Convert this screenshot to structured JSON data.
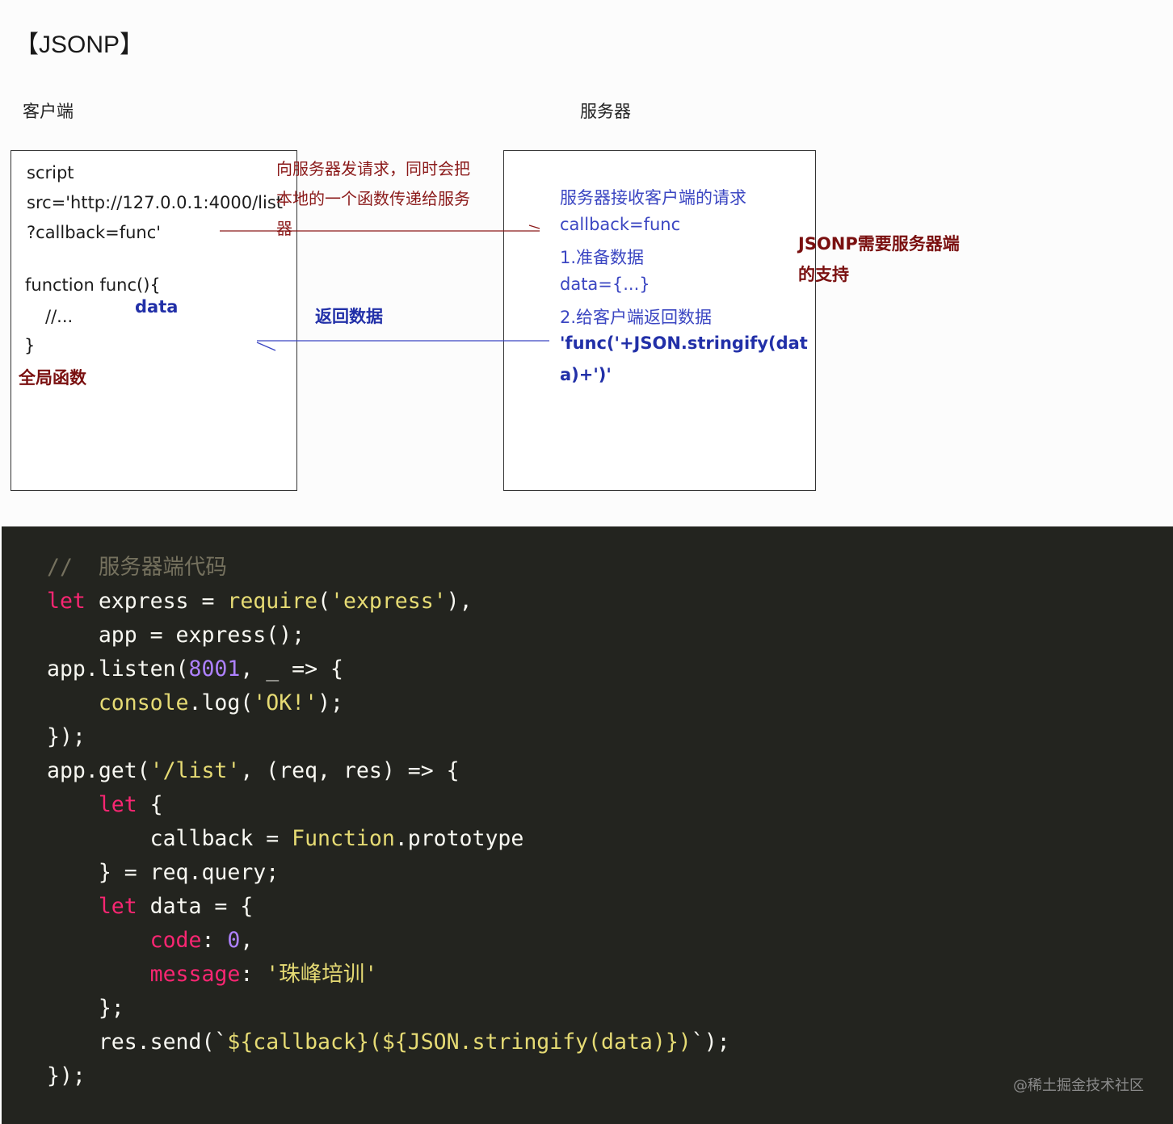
{
  "diagram": {
    "title": "【JSONP】",
    "client_label": "客户端",
    "server_label": "服务器",
    "client_box": {
      "line1": "script",
      "line2": "src='http://127.0.0.1:4000/list",
      "line3": "?callback=func'",
      "line4": "function func(){",
      "line5": "//...",
      "line6": "}",
      "data_label": "data",
      "global_label": "全局函数"
    },
    "request_note": {
      "line1": "向服务器发请求，同时会把",
      "line2": "本地的一个函数传递给服务",
      "line3": "器"
    },
    "return_label": "返回数据",
    "server_box": {
      "line1": "服务器接收客户端的请求",
      "line2": "callback=func",
      "line3": "1.准备数据",
      "line4": "data={...}",
      "line5": "2.给客户端返回数据",
      "line6": "'func('+JSON.stringify(dat",
      "line7": "a)+')'"
    },
    "side_note": {
      "line1": "JSONP需要服务器端",
      "line2": "的支持"
    }
  },
  "code": {
    "lines": [
      [
        {
          "t": "//  服务器端代码",
          "c": "cm"
        }
      ],
      [
        {
          "t": "let",
          "c": "kw"
        },
        {
          "t": " express = ",
          "c": "plain"
        },
        {
          "t": "require",
          "c": "fn"
        },
        {
          "t": "(",
          "c": "plain"
        },
        {
          "t": "'express'",
          "c": "str"
        },
        {
          "t": "),",
          "c": "plain"
        }
      ],
      [
        {
          "t": "    app = express();",
          "c": "plain"
        }
      ],
      [
        {
          "t": "app.listen(",
          "c": "plain"
        },
        {
          "t": "8001",
          "c": "num"
        },
        {
          "t": ", _ => {",
          "c": "plain"
        }
      ],
      [
        {
          "t": "    ",
          "c": "plain"
        },
        {
          "t": "console",
          "c": "fn"
        },
        {
          "t": ".log(",
          "c": "plain"
        },
        {
          "t": "'OK!'",
          "c": "str"
        },
        {
          "t": ");",
          "c": "plain"
        }
      ],
      [
        {
          "t": "});",
          "c": "plain"
        }
      ],
      [
        {
          "t": "app.get(",
          "c": "plain"
        },
        {
          "t": "'/list'",
          "c": "str"
        },
        {
          "t": ", (req, res) => {",
          "c": "plain"
        }
      ],
      [
        {
          "t": "    ",
          "c": "plain"
        },
        {
          "t": "let",
          "c": "kw"
        },
        {
          "t": " {",
          "c": "plain"
        }
      ],
      [
        {
          "t": "        callback = ",
          "c": "plain"
        },
        {
          "t": "Function",
          "c": "fn"
        },
        {
          "t": ".prototype",
          "c": "plain"
        }
      ],
      [
        {
          "t": "    } = req.query;",
          "c": "plain"
        }
      ],
      [
        {
          "t": "    ",
          "c": "plain"
        },
        {
          "t": "let",
          "c": "kw"
        },
        {
          "t": " data = {",
          "c": "plain"
        }
      ],
      [
        {
          "t": "        ",
          "c": "plain"
        },
        {
          "t": "code",
          "c": "prop"
        },
        {
          "t": ": ",
          "c": "plain"
        },
        {
          "t": "0",
          "c": "num"
        },
        {
          "t": ",",
          "c": "plain"
        }
      ],
      [
        {
          "t": "        ",
          "c": "plain"
        },
        {
          "t": "message",
          "c": "prop"
        },
        {
          "t": ": ",
          "c": "plain"
        },
        {
          "t": "'珠峰培训'",
          "c": "str"
        }
      ],
      [
        {
          "t": "    };",
          "c": "plain"
        }
      ],
      [
        {
          "t": "    res.send(`",
          "c": "plain"
        },
        {
          "t": "${callback}(${JSON.stringify(data)})",
          "c": "fn"
        },
        {
          "t": "`);",
          "c": "plain"
        }
      ],
      [
        {
          "t": "});",
          "c": "plain"
        }
      ]
    ]
  },
  "watermark": "@稀土掘金技术社区"
}
